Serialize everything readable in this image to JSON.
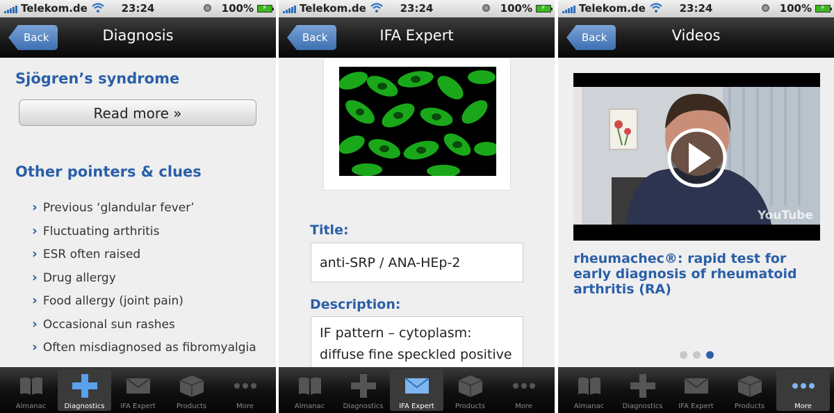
{
  "status": {
    "carrier": "Telekom.de",
    "time": "23:24",
    "battery": "100%"
  },
  "back_label": "Back",
  "tabs": [
    "Almanac",
    "Diagnostics",
    "IFA Expert",
    "Products",
    "More"
  ],
  "colors": {
    "accent": "#2a5fa8",
    "nav_dark": "#111111",
    "tab_active": "#3a3a3a"
  },
  "screens": {
    "diagnosis": {
      "title": "Diagnosis",
      "heading": "Sjögren’s syndrome",
      "read_more": "Read more »",
      "pointers_heading": "Other pointers & clues",
      "pointers": [
        "Previous ‘glandular fever’",
        "Fluctuating arthritis",
        "ESR often raised",
        "Drug allergy",
        "Food allergy (joint pain)",
        "Occasional sun rashes",
        "Often misdiagnosed as fibromyalgia"
      ],
      "active_tab": "Diagnostics"
    },
    "ifa": {
      "title": "IFA Expert",
      "title_label": "Title:",
      "title_value": "anti-SRP / ANA-HEp-2",
      "description_label": "Description:",
      "description_lines": [
        "IF pattern – cytoplasm:",
        "diffuse fine speckled positive"
      ],
      "active_tab": "IFA Expert"
    },
    "videos": {
      "title": "Videos",
      "video_title": "rheumachec®: rapid test for early diagnosis of rheumatoid arthritis (RA)",
      "watermark": "YouTube",
      "page_index": 3,
      "page_count": 3,
      "active_tab": "More"
    }
  }
}
